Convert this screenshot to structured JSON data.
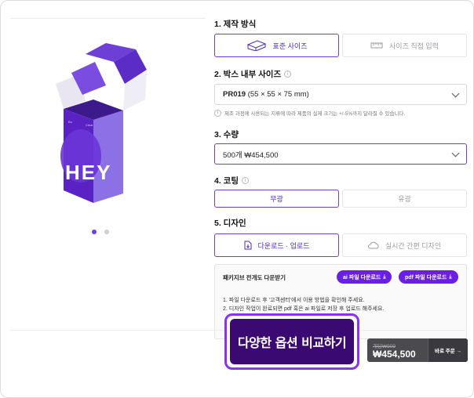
{
  "gallery": {
    "box_brand_left": "Bo",
    "box_brand_right": "Clear",
    "box_big_text": "HEY",
    "dots_total": 2,
    "dots_active_index": 0
  },
  "sections": {
    "production": {
      "title": "1. 제작 방식",
      "options": [
        {
          "label": "표준 사이즈",
          "icon": "box-icon",
          "selected": true
        },
        {
          "label": "사이즈 직접 입력",
          "icon": "ruler-icon",
          "selected": false
        }
      ]
    },
    "size": {
      "title": "2. 박스 내부 사이즈",
      "select_code": "PR019",
      "select_dims": "(55 × 55 × 75 mm)",
      "note": "제조 과정에 사용되는 지류에 따라 제품의 실제 크기는 +/-5%까지 달라질 수 있습니다."
    },
    "quantity": {
      "title": "3. 수량",
      "select_value": "500개 ₩454,500"
    },
    "coating": {
      "title": "4. 코팅",
      "options": [
        {
          "label": "무광",
          "selected": true
        },
        {
          "label": "유광",
          "selected": false
        }
      ]
    },
    "design": {
      "title": "5. 디자인",
      "options": [
        {
          "label": "다운로드 · 업로드",
          "icon": "file-icon",
          "selected": true
        },
        {
          "label": "실시간 간편 디자인",
          "icon": "cloud-icon",
          "selected": false
        }
      ],
      "panel_title": "패키지브 전개도 다운받기",
      "ai_button": "ai 파일 다운로드",
      "pdf_button": "pdf 파일 다운로드",
      "line1": "1. 파일 다운로드 후 '고객센터'에서 이용 방법을 확인해 주세요.",
      "line2": "2. 디자인 작업이 완료되면 pdf 혹은 ai 파일로 저장 후 업로드 해주세요."
    }
  },
  "purchase": {
    "compare_button": "다양한 옵션 비교하기",
    "strike_price": "개당₩909",
    "total_price": "₩454,500",
    "order_button": "바로 주문 →"
  },
  "colors": {
    "accent": "#6a3fe0",
    "cta_bg": "#3a0a72",
    "cta_ring": "#8b32f0",
    "pill_bg": "#6a20e0",
    "price_bar": "#4a4a4f"
  }
}
